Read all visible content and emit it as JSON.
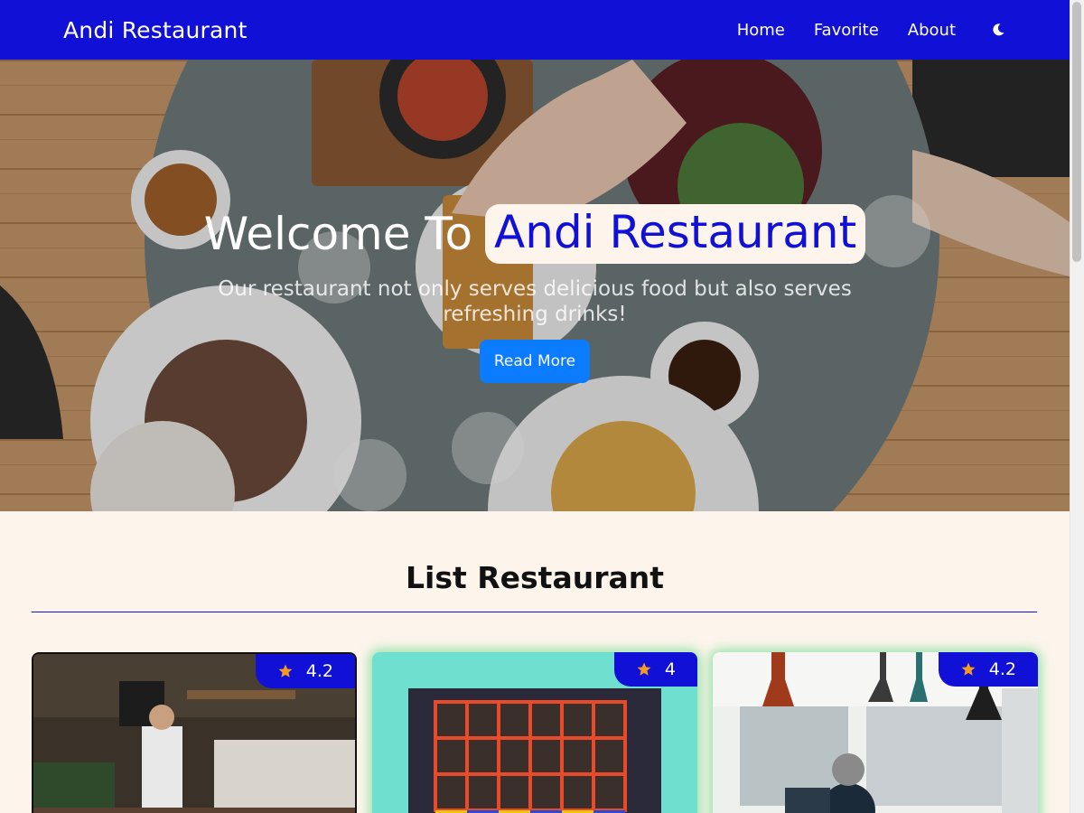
{
  "navbar": {
    "brand": "Andi Restaurant",
    "links": [
      "Home",
      "Favorite",
      "About"
    ],
    "theme_icon": "moon-icon",
    "color": "#1010d6"
  },
  "hero": {
    "title_prefix": "Welcome To",
    "title_highlight": "Andi Restaurant",
    "subtitle": "Our restaurant not only serves delicious food but also serves refreshing drinks!",
    "button_label": "Read More",
    "button_color": "#0b7bff"
  },
  "list": {
    "title": "List Restaurant",
    "cards": [
      {
        "rating": "4.2",
        "image": "cafe-interior-photo"
      },
      {
        "rating": "4",
        "image": "turquoise-storefront-photo"
      },
      {
        "rating": "4.2",
        "image": "window-seating-photo"
      }
    ]
  },
  "colors": {
    "accent": "#1010d6",
    "background": "#fdf5ec",
    "star": "#f59a23"
  }
}
